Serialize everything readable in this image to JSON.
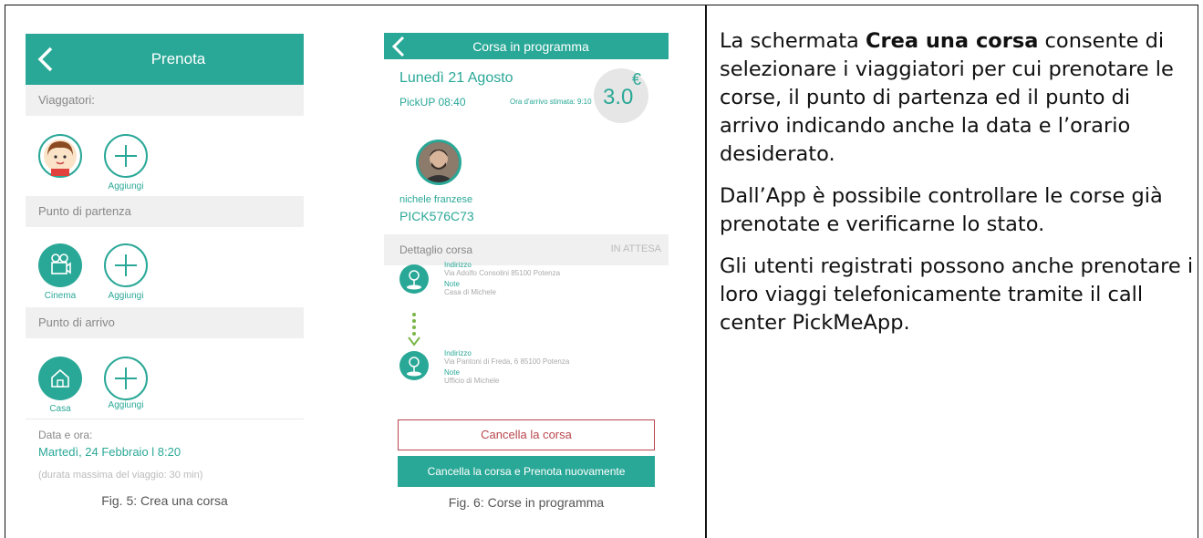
{
  "colors": {
    "accent": "#2aa897",
    "danger": "#b9474d"
  },
  "fig5": {
    "header_title": "Prenota",
    "sections": {
      "travelers": "Viaggatori:",
      "departure": "Punto di partenza",
      "arrival": "Punto di arrivo"
    },
    "add_label": "Aggiungi",
    "departure_place": "Cinema",
    "arrival_place": "Casa",
    "date_label": "Data e ora:",
    "date_value": "Martedì, 24 Febbraio l 8:20",
    "duration_note": "(durata massima del viaggio: 30 min)",
    "caption": "Fig. 5: Crea una corsa"
  },
  "fig6": {
    "header_title": "Corsa in programma",
    "day": "Lunedì 21 Agosto",
    "pickup": "PickUP 08:40",
    "eta": "Ora d'arrivo stimata: 9:10",
    "price": "3.0",
    "currency": "€",
    "passenger_name": "nichele franzese",
    "code": "PICK576C73",
    "detail_label": "Dettaglio corsa",
    "status": "IN ATTESA",
    "stop1": {
      "address_label": "Indirizzo",
      "address": "Via Adolfo Consolini 85100 Potenza",
      "note_label": "Note",
      "note": "Casa di Michele"
    },
    "stop2": {
      "address_label": "Indirizzo",
      "address": "Via Pantoni di Freda, 6 85100 Potenza",
      "note_label": "Note",
      "note": "Ufficio di Michele"
    },
    "cancel_button": "Cancella la corsa",
    "rebook_button": "Cancella la corsa e Prenota nuovamente",
    "caption": "Fig. 6: Corse in programma"
  },
  "text": {
    "p1_pre": "La schermata ",
    "p1_bold": "Crea una corsa",
    "p1_post": " consente di selezionare i viaggiatori per cui prenotare le corse, il punto di partenza ed il punto di arrivo indicando anche la data e l’orario desiderato.",
    "p2": "Dall’App è possibile controllare le corse già prenotate e verificarne lo stato.",
    "p3": "Gli utenti registrati possono anche prenotare i loro viaggi telefonicamente tramite il call center PickMeApp."
  }
}
